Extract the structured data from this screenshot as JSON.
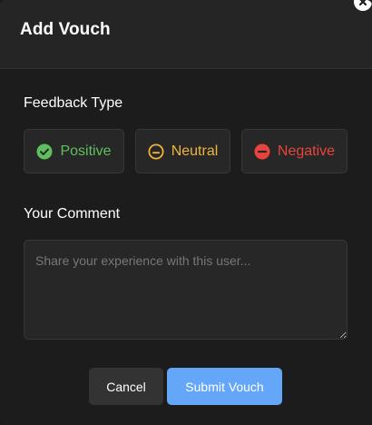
{
  "modal": {
    "title": "Add Vouch"
  },
  "feedback": {
    "label": "Feedback Type",
    "options": [
      {
        "label": "Positive",
        "icon": "check-circle-icon",
        "color": "#5fbf5f"
      },
      {
        "label": "Neutral",
        "icon": "neutral-face-icon",
        "color": "#f0b43c"
      },
      {
        "label": "Negative",
        "icon": "minus-circle-icon",
        "color": "#e8443d"
      }
    ]
  },
  "comment": {
    "label": "Your Comment",
    "placeholder": "Share your experience with this user..."
  },
  "actions": {
    "cancel_label": "Cancel",
    "submit_label": "Submit Vouch"
  }
}
